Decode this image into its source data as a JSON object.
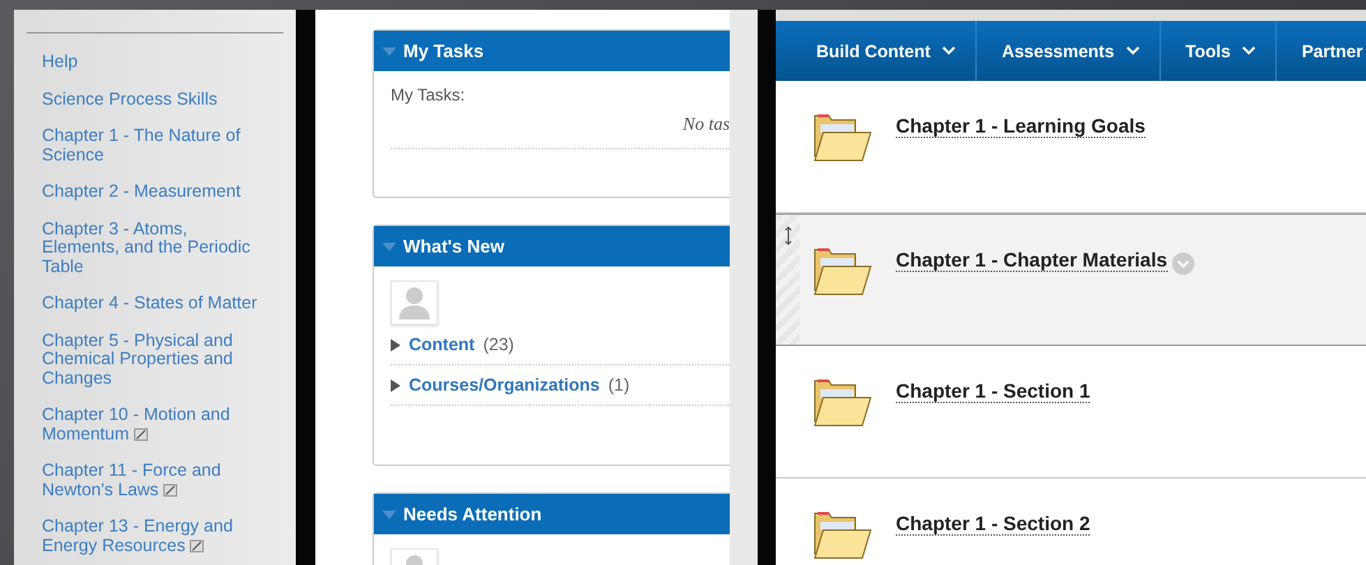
{
  "sidebar": {
    "items": [
      {
        "label": "Help",
        "kind": "plain"
      },
      {
        "label": "Science Process Skills",
        "kind": "plain"
      },
      {
        "label": "Chapter 1 - The Nature of Science",
        "kind": "plain"
      },
      {
        "label": "Chapter 2 - Measurement",
        "kind": "plain"
      },
      {
        "label": "Chapter 3 - Atoms, Elements, and the Periodic Table",
        "kind": "plain"
      },
      {
        "label": "Chapter 4 - States of Matter",
        "kind": "plain"
      },
      {
        "label": "Chapter 5 - Physical and Chemical Properties and Changes",
        "kind": "plain"
      },
      {
        "label": "Chapter 10 - Motion and Momentum",
        "kind": "external"
      },
      {
        "label": "Chapter 11 - Force and Newton's Laws",
        "kind": "external"
      },
      {
        "label": "Chapter 13 - Energy and Energy Resources",
        "kind": "external"
      }
    ]
  },
  "modules": [
    {
      "title": "My Tasks",
      "kind": "tasks",
      "label": "My Tasks:",
      "message": "No tas"
    },
    {
      "title": "What's New",
      "kind": "updates",
      "entries": [
        {
          "label": "Content",
          "count": "(23)"
        },
        {
          "label": "Courses/Organizations",
          "count": "(1)"
        }
      ]
    },
    {
      "title": "Needs Attention",
      "kind": "updates"
    }
  ],
  "content": {
    "menu": [
      {
        "label": "Build Content"
      },
      {
        "label": "Assessments"
      },
      {
        "label": "Tools"
      },
      {
        "label": "Partner"
      }
    ],
    "items": [
      {
        "title": "Chapter 1 - Learning Goals",
        "selected": false
      },
      {
        "title": "Chapter 1 - Chapter Materials",
        "selected": true
      },
      {
        "title": "Chapter 1 - Section 1",
        "selected": false
      },
      {
        "title": "Chapter 1 - Section 2",
        "selected": false
      }
    ]
  }
}
